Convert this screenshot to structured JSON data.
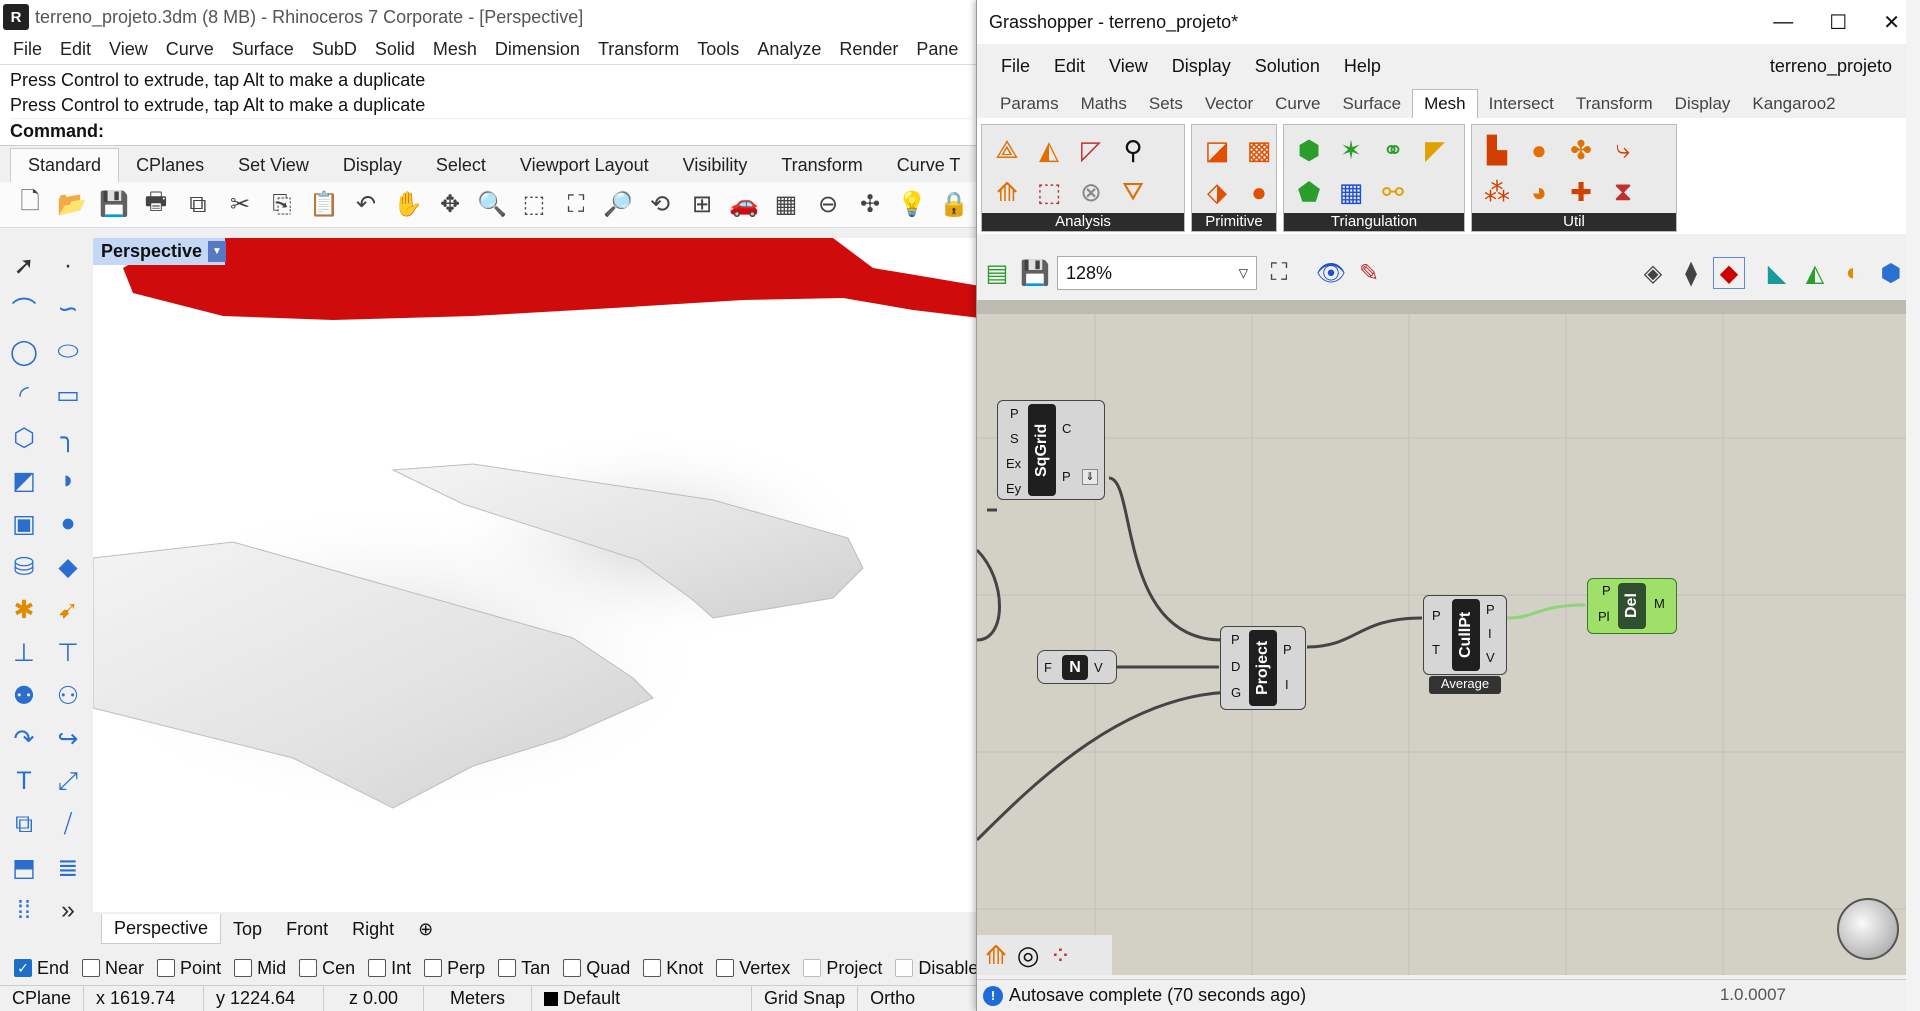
{
  "rhino": {
    "title": "terreno_projeto.3dm (8 MB) - Rhinoceros 7 Corporate - [Perspective]",
    "menu": [
      "File",
      "Edit",
      "View",
      "Curve",
      "Surface",
      "SubD",
      "Solid",
      "Mesh",
      "Dimension",
      "Transform",
      "Tools",
      "Analyze",
      "Render",
      "Pane"
    ],
    "history": [
      "Press Control to extrude, tap Alt to make a duplicate",
      "Press Control to extrude, tap Alt to make a duplicate"
    ],
    "command_label": "Command:",
    "tabs": [
      "Standard",
      "CPlanes",
      "Set View",
      "Display",
      "Select",
      "Viewport Layout",
      "Visibility",
      "Transform",
      "Curve T"
    ],
    "viewport_title": "Perspective",
    "viewport_tabs": [
      "Perspective",
      "Top",
      "Front",
      "Right"
    ],
    "osnaps": [
      {
        "label": "End",
        "checked": true
      },
      {
        "label": "Near",
        "checked": false
      },
      {
        "label": "Point",
        "checked": false
      },
      {
        "label": "Mid",
        "checked": false
      },
      {
        "label": "Cen",
        "checked": false
      },
      {
        "label": "Int",
        "checked": false
      },
      {
        "label": "Perp",
        "checked": false
      },
      {
        "label": "Tan",
        "checked": false
      },
      {
        "label": "Quad",
        "checked": false
      },
      {
        "label": "Knot",
        "checked": false
      },
      {
        "label": "Vertex",
        "checked": false
      },
      {
        "label": "Project",
        "checked": false
      },
      {
        "label": "Disable",
        "checked": false
      }
    ],
    "status": {
      "cplane": "CPlane",
      "x": "x 1619.74",
      "y": "y 1224.64",
      "z": "z 0.00",
      "units": "Meters",
      "layer": "Default",
      "grid_snap": "Grid Snap",
      "ortho": "Ortho"
    }
  },
  "gh": {
    "title": "Grasshopper - terreno_projeto*",
    "menu": [
      "File",
      "Edit",
      "View",
      "Display",
      "Solution",
      "Help"
    ],
    "doc_name": "terreno_projeto",
    "tabs": [
      "Params",
      "Maths",
      "Sets",
      "Vector",
      "Curve",
      "Surface",
      "Mesh",
      "Intersect",
      "Transform",
      "Display",
      "Kangaroo2"
    ],
    "active_tab": "Mesh",
    "panels": [
      "Analysis",
      "Primitive",
      "Triangulation",
      "Util"
    ],
    "zoom": "128%",
    "components": {
      "sqgrid": {
        "name": "SqGrid",
        "inputs": [
          "P",
          "S",
          "Ex",
          "Ey"
        ],
        "outputs": [
          "C",
          "P"
        ]
      },
      "vector_n": {
        "name": "N",
        "inputs": [
          "F"
        ],
        "outputs": [
          "V"
        ]
      },
      "project": {
        "name": "Project",
        "inputs": [
          "P",
          "D",
          "G"
        ],
        "outputs": [
          "P",
          "I"
        ]
      },
      "cullpt": {
        "name": "CullPt",
        "inputs": [
          "P",
          "T"
        ],
        "outputs": [
          "P",
          "I",
          "V"
        ],
        "footer": "Average"
      },
      "del": {
        "name": "Del",
        "inputs": [
          "P",
          "Pl"
        ],
        "outputs": [
          "M"
        ]
      }
    },
    "status": "Autosave complete (70 seconds ago)",
    "version": "1.0.0007"
  }
}
